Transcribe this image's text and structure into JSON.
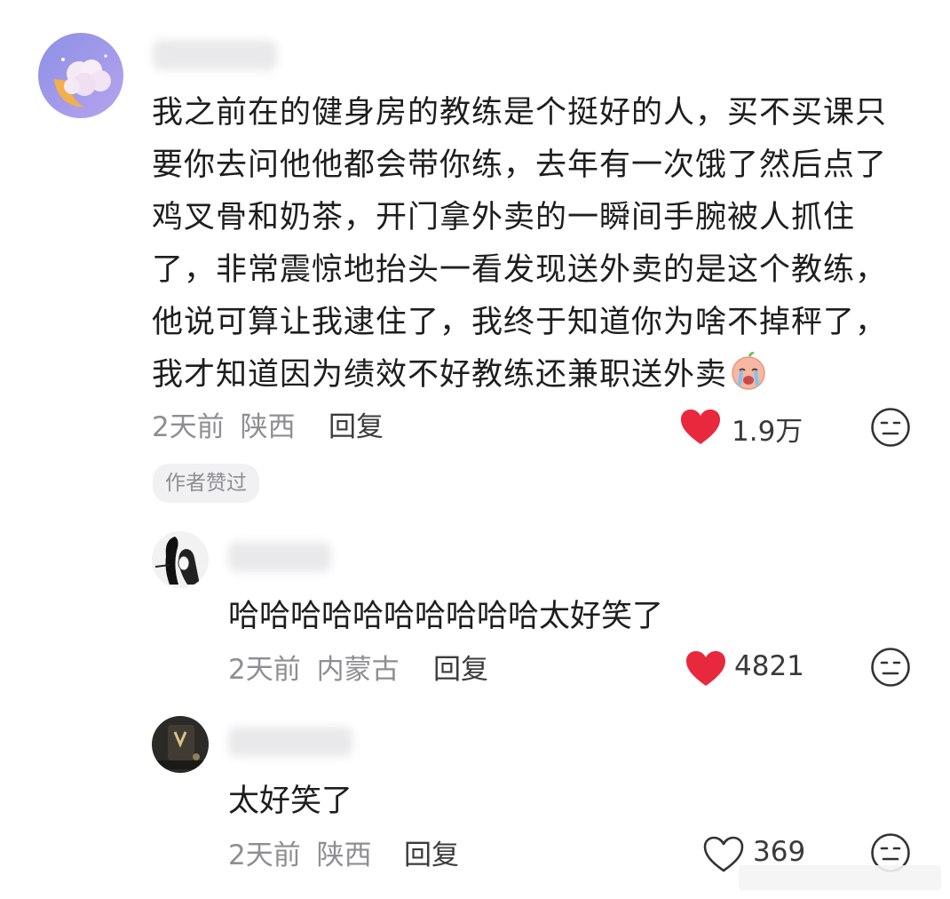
{
  "comments": [
    {
      "body_lines": [
        "我之前在的健身房的教练是个挺好的人，买不买课只",
        "要你去问他他都会带你练，去年有一次饿了然后点了",
        "鸡叉骨和奶茶，开门拿外卖的一瞬间手腕被人抓住",
        "了，非常震惊地抬头一看发现送外卖的是这个教练，",
        "他说可算让我逮住了，我终于知道你为啥不掉秤了，",
        "我才知道因为绩效不好教练还兼职送外卖"
      ],
      "inline_emoji": "crying-face-emoji",
      "time": "2天前",
      "location": "陕西",
      "reply_label": "回复",
      "likes": "1.9万",
      "liked": true,
      "author_tag": "作者赞过"
    },
    {
      "body": "哈哈哈哈哈哈哈哈哈哈太好笑了",
      "time": "2天前",
      "location": "内蒙古",
      "reply_label": "回复",
      "likes": "4821",
      "liked": true
    },
    {
      "body": "太好笑了",
      "time": "2天前",
      "location": "陕西",
      "reply_label": "回复",
      "likes": "369",
      "liked": false
    }
  ],
  "colors": {
    "like_red": "#e8283c",
    "meta_gray": "#8e8e93",
    "text": "#1e1e1e"
  },
  "icons": [
    "heart-icon",
    "neutral-face-icon",
    "crying-face-emoji"
  ]
}
